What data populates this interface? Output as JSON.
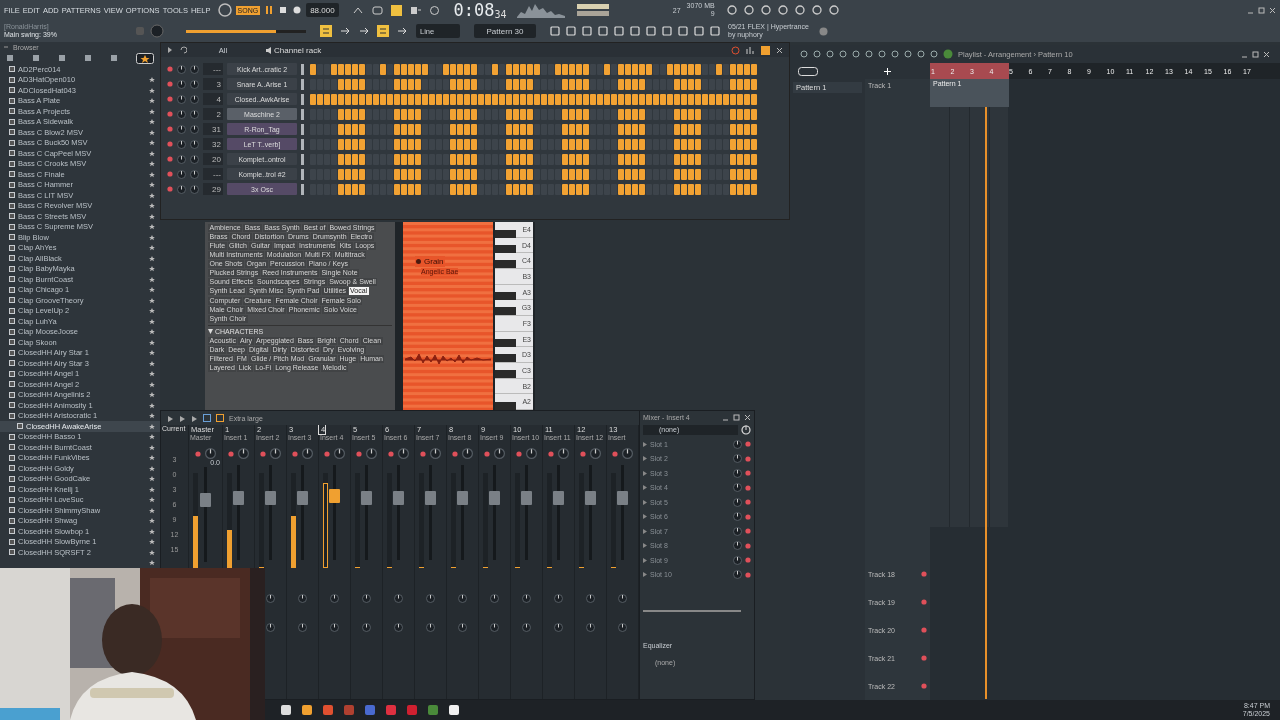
{
  "toolbar": {
    "menu": [
      "FILE",
      "EDIT",
      "ADD",
      "PATTERNS",
      "VIEW",
      "OPTIONS",
      "TOOLS",
      "HELP"
    ],
    "mode": "SONG",
    "tempo": "88.000",
    "time": "0:08",
    "time_small": "34",
    "cpu": "27",
    "memory": "3070 MB",
    "polyphony": "9",
    "hint_title": "[RonaldHarris]",
    "hint": "Main swing: 39%",
    "swing": {
      "level": 0.75
    },
    "snap": "Line",
    "pattern": "Pattern 30",
    "news": "05/21 FLEX | Hypertrance",
    "news_by": "by nuphory"
  },
  "browser": {
    "title": "Browser",
    "items": [
      {
        "label": "AD2Perc014",
        "selected": false
      },
      {
        "label": "AD3HatOpen010",
        "selected": false
      },
      {
        "label": "ADClosedHat043",
        "selected": false
      },
      {
        "label": "Bass A Plate",
        "selected": false
      },
      {
        "label": "Bass A Projects",
        "selected": false
      },
      {
        "label": "Bass A Sidewalk",
        "selected": false
      },
      {
        "label": "Bass C Blow2 MSV",
        "selected": false
      },
      {
        "label": "Bass C Buck50 MSV",
        "selected": false
      },
      {
        "label": "Bass C CapPeel MSV",
        "selected": false
      },
      {
        "label": "Bass C Crooks MSV",
        "selected": false
      },
      {
        "label": "Bass C Finale",
        "selected": false
      },
      {
        "label": "Bass C Hammer",
        "selected": false
      },
      {
        "label": "Bass C LIT MSV",
        "selected": false
      },
      {
        "label": "Bass C Revolver MSV",
        "selected": false
      },
      {
        "label": "Bass C Streets MSV",
        "selected": false
      },
      {
        "label": "Bass C Supreme MSV",
        "selected": false
      },
      {
        "label": "Blip Blow",
        "selected": false
      },
      {
        "label": "Clap AhYes",
        "selected": false
      },
      {
        "label": "Clap AllBlack",
        "selected": false
      },
      {
        "label": "Clap BabyMayka",
        "selected": false
      },
      {
        "label": "Clap BurntCoast",
        "selected": false
      },
      {
        "label": "Clap Chicago 1",
        "selected": false
      },
      {
        "label": "Clap GrooveTheory",
        "selected": false
      },
      {
        "label": "Clap LevelUp 2",
        "selected": false
      },
      {
        "label": "Clap LuhYa",
        "selected": false
      },
      {
        "label": "Clap MooseJoose",
        "selected": false
      },
      {
        "label": "Clap Skoon",
        "selected": false
      },
      {
        "label": "ClosedHH Airy Star 1",
        "selected": false
      },
      {
        "label": "ClosedHH Airy Star 3",
        "selected": false
      },
      {
        "label": "ClosedHH Angel 1",
        "selected": false
      },
      {
        "label": "ClosedHH Angel 2",
        "selected": false
      },
      {
        "label": "ClosedHH Angelinis 2",
        "selected": false
      },
      {
        "label": "ClosedHH Animosity 1",
        "selected": false
      },
      {
        "label": "ClosedHH Aristocratic 1",
        "selected": false
      },
      {
        "label": "ClosedHH AwakeArise",
        "selected": true
      },
      {
        "label": "ClosedHH Basso 1",
        "selected": false
      },
      {
        "label": "ClosedHH BurntCoast",
        "selected": false
      },
      {
        "label": "ClosedHH FunkVibes",
        "selected": false
      },
      {
        "label": "ClosedHH Goldy",
        "selected": false
      },
      {
        "label": "ClosedHH GoodCake",
        "selected": false
      },
      {
        "label": "ClosedHH Knellj 1",
        "selected": false
      },
      {
        "label": "ClosedHH LoveSuc",
        "selected": false
      },
      {
        "label": "ClosedHH ShimmyShaw",
        "selected": false
      },
      {
        "label": "ClosedHH Shwag",
        "selected": false
      },
      {
        "label": "ClosedHH Slowbop 1",
        "selected": false
      },
      {
        "label": "ClosedHH SlowByrne 1",
        "selected": false
      },
      {
        "label": "ClosedHH SQRSFT 2",
        "selected": false
      }
    ]
  },
  "channel_rack": {
    "filter": "All",
    "title": "Channel rack",
    "channels": [
      {
        "number": "---",
        "name": "Kick Art..cratic 2",
        "color": "#3b4148",
        "steps": [
          true,
          false,
          false,
          true,
          true,
          true,
          true,
          true,
          false,
          false,
          true,
          false,
          true,
          true,
          true,
          true,
          true,
          false,
          false,
          true,
          true,
          true,
          true,
          true,
          false,
          false,
          true,
          false,
          true,
          true,
          true,
          true,
          true,
          false,
          false,
          true,
          true,
          true,
          true,
          true,
          false,
          false,
          true,
          false,
          true,
          true,
          true,
          true,
          true,
          false,
          false,
          true,
          true,
          true,
          true,
          true,
          false,
          false,
          true,
          false,
          true,
          true,
          true,
          true
        ]
      },
      {
        "number": "3",
        "name": "Snare A..Arise 1",
        "color": "#3b4148",
        "steps": [
          false,
          false,
          false,
          false,
          true,
          true,
          true,
          true,
          false,
          false,
          false,
          false,
          true,
          true,
          true,
          true,
          false,
          false,
          false,
          false,
          true,
          true,
          true,
          true,
          false,
          false,
          false,
          false,
          true,
          true,
          true,
          true,
          false,
          false,
          false,
          false,
          true,
          true,
          true,
          true,
          false,
          false,
          false,
          false,
          true,
          true,
          true,
          true,
          false,
          false,
          false,
          false,
          true,
          true,
          true,
          true,
          false,
          false,
          false,
          false,
          true,
          true,
          true,
          true
        ]
      },
      {
        "number": "4",
        "name": "Closed..AwkArise",
        "color": "#3b4148",
        "steps": [
          true,
          true,
          true,
          true,
          true,
          true,
          true,
          true,
          true,
          true,
          true,
          true,
          true,
          true,
          true,
          true,
          true,
          true,
          true,
          true,
          true,
          true,
          true,
          true,
          true,
          true,
          true,
          true,
          true,
          true,
          true,
          true,
          true,
          true,
          true,
          true,
          true,
          true,
          true,
          true,
          true,
          true,
          true,
          true,
          true,
          true,
          true,
          true,
          true,
          true,
          true,
          true,
          true,
          true,
          true,
          true,
          true,
          true,
          true,
          true,
          true,
          true,
          true,
          true
        ]
      },
      {
        "number": "2",
        "name": "Maschine 2",
        "color": "#5a6068",
        "steps": [
          false,
          false,
          false,
          false,
          true,
          true,
          true,
          true,
          false,
          false,
          false,
          false,
          true,
          true,
          true,
          true,
          false,
          false,
          false,
          false,
          true,
          true,
          true,
          true,
          false,
          false,
          false,
          false,
          true,
          true,
          true,
          true,
          false,
          false,
          false,
          false,
          true,
          true,
          true,
          true,
          false,
          false,
          false,
          false,
          true,
          true,
          true,
          true,
          false,
          false,
          false,
          false,
          true,
          true,
          true,
          true,
          false,
          false,
          false,
          false,
          true,
          true,
          true,
          true
        ]
      },
      {
        "number": "31",
        "name": "R-Ron_Tag",
        "color": "#554a66",
        "steps": [
          false,
          false,
          false,
          false,
          true,
          true,
          true,
          true,
          false,
          false,
          false,
          false,
          true,
          true,
          true,
          true,
          false,
          false,
          false,
          false,
          true,
          true,
          true,
          true,
          false,
          false,
          false,
          false,
          true,
          true,
          true,
          true,
          false,
          false,
          false,
          false,
          true,
          true,
          true,
          true,
          false,
          false,
          false,
          false,
          true,
          true,
          true,
          true,
          false,
          false,
          false,
          false,
          true,
          true,
          true,
          true,
          false,
          false,
          false,
          false,
          true,
          true,
          true,
          true
        ]
      },
      {
        "number": "32",
        "name": "LeT T..verb]",
        "color": "#554a66",
        "steps": [
          false,
          false,
          false,
          false,
          true,
          true,
          true,
          true,
          false,
          false,
          false,
          false,
          true,
          true,
          true,
          true,
          false,
          false,
          false,
          false,
          true,
          true,
          true,
          true,
          false,
          false,
          false,
          false,
          true,
          true,
          true,
          true,
          false,
          false,
          false,
          false,
          true,
          true,
          true,
          true,
          false,
          false,
          false,
          false,
          true,
          true,
          true,
          true,
          false,
          false,
          false,
          false,
          true,
          true,
          true,
          true,
          false,
          false,
          false,
          false,
          true,
          true,
          true,
          true
        ]
      },
      {
        "number": "20",
        "name": "Komplet..ontrol",
        "color": "#3b4148",
        "steps": [
          false,
          false,
          false,
          false,
          true,
          true,
          true,
          true,
          false,
          false,
          false,
          false,
          true,
          true,
          true,
          true,
          false,
          false,
          false,
          false,
          true,
          true,
          true,
          true,
          false,
          false,
          false,
          false,
          true,
          true,
          true,
          true,
          false,
          false,
          false,
          false,
          true,
          true,
          true,
          true,
          false,
          false,
          false,
          false,
          true,
          true,
          true,
          true,
          false,
          false,
          false,
          false,
          true,
          true,
          true,
          true,
          false,
          false,
          false,
          false,
          true,
          true,
          true,
          true
        ]
      },
      {
        "number": "---",
        "name": "Komple..trol #2",
        "color": "#3b4148",
        "steps": [
          false,
          false,
          false,
          false,
          true,
          true,
          true,
          true,
          false,
          false,
          false,
          false,
          true,
          true,
          true,
          true,
          false,
          false,
          false,
          false,
          true,
          true,
          true,
          true,
          false,
          false,
          false,
          false,
          true,
          true,
          true,
          true,
          false,
          false,
          false,
          false,
          true,
          true,
          true,
          true,
          false,
          false,
          false,
          false,
          true,
          true,
          true,
          true,
          false,
          false,
          false,
          false,
          true,
          true,
          true,
          true,
          false,
          false,
          false,
          false,
          true,
          true,
          true,
          true
        ]
      },
      {
        "number": "29",
        "name": "3x Osc",
        "color": "#554a66",
        "steps": [
          false,
          false,
          false,
          false,
          true,
          true,
          true,
          true,
          false,
          false,
          false,
          false,
          true,
          true,
          true,
          true,
          false,
          false,
          false,
          false,
          true,
          true,
          true,
          true,
          false,
          false,
          false,
          false,
          true,
          true,
          true,
          true,
          false,
          false,
          false,
          false,
          true,
          true,
          true,
          true,
          false,
          false,
          false,
          false,
          true,
          true,
          true,
          true,
          false,
          false,
          false,
          false,
          true,
          true,
          true,
          true,
          false,
          false,
          false,
          false,
          true,
          true,
          true,
          true
        ]
      }
    ]
  },
  "tag_panel": {
    "types": [
      {
        "label": "Ambience",
        "selected": false
      },
      {
        "label": "Bass",
        "selected": false
      },
      {
        "label": "Bass Synth",
        "selected": false
      },
      {
        "label": "Best of",
        "selected": false
      },
      {
        "label": "Bowed Strings",
        "selected": false
      },
      {
        "label": "Brass",
        "selected": false
      },
      {
        "label": "Chord",
        "selected": false
      },
      {
        "label": "Distortion",
        "selected": false
      },
      {
        "label": "Drums",
        "selected": false
      },
      {
        "label": "Drumsynth",
        "selected": false
      },
      {
        "label": "Electro",
        "selected": false
      },
      {
        "label": "Flute",
        "selected": false
      },
      {
        "label": "Glitch",
        "selected": false
      },
      {
        "label": "Guitar",
        "selected": false
      },
      {
        "label": "Impact",
        "selected": false
      },
      {
        "label": "Instruments",
        "selected": false
      },
      {
        "label": "Kits",
        "selected": false
      },
      {
        "label": "Loops",
        "selected": false
      },
      {
        "label": "Multi Instruments",
        "selected": false
      },
      {
        "label": "Modulation",
        "selected": false
      },
      {
        "label": "Multi FX",
        "selected": false
      },
      {
        "label": "Multitrack",
        "selected": false
      },
      {
        "label": "One Shots",
        "selected": false
      },
      {
        "label": "Organ",
        "selected": false
      },
      {
        "label": "Percussion",
        "selected": false
      },
      {
        "label": "Piano / Keys",
        "selected": false
      },
      {
        "label": "Plucked Strings",
        "selected": false
      },
      {
        "label": "Reed Instruments",
        "selected": false
      },
      {
        "label": "Single Note",
        "selected": false
      },
      {
        "label": "Sound Effects",
        "selected": false
      },
      {
        "label": "Soundscapes",
        "selected": false
      },
      {
        "label": "Strings",
        "selected": false
      },
      {
        "label": "Swoop & Swell",
        "selected": false
      },
      {
        "label": "Synth Lead",
        "selected": false
      },
      {
        "label": "Synth Misc",
        "selected": false
      },
      {
        "label": "Synth Pad",
        "selected": false
      },
      {
        "label": "Utilities",
        "selected": false
      },
      {
        "label": "Vocal",
        "selected": true
      }
    ],
    "subtypes": [
      {
        "label": "Computer",
        "selected": false
      },
      {
        "label": "Creature",
        "selected": false
      },
      {
        "label": "Female Choir",
        "selected": false
      },
      {
        "label": "Female Solo",
        "selected": false
      },
      {
        "label": "Male Choir",
        "selected": false
      },
      {
        "label": "Mixed Choir",
        "selected": false
      },
      {
        "label": "Phonemic",
        "selected": false
      },
      {
        "label": "Solo Voice",
        "selected": false
      },
      {
        "label": "Synth Choir",
        "selected": false
      }
    ],
    "characters_title": "CHARACTERS",
    "characters": [
      {
        "label": "Acoustic",
        "selected": false
      },
      {
        "label": "Airy",
        "selected": false
      },
      {
        "label": "Arpeggiated",
        "selected": false
      },
      {
        "label": "Bass",
        "selected": false
      },
      {
        "label": "Bright",
        "selected": false
      },
      {
        "label": "Chord",
        "selected": false
      },
      {
        "label": "Clean",
        "selected": false
      },
      {
        "label": "Dark",
        "selected": false
      },
      {
        "label": "Deep",
        "selected": false
      },
      {
        "label": "Digital",
        "selected": false
      },
      {
        "label": "Dirty",
        "selected": false
      },
      {
        "label": "Distorted",
        "selected": false
      },
      {
        "label": "Dry",
        "selected": false
      },
      {
        "label": "Evolving",
        "selected": false
      },
      {
        "label": "Filtered",
        "selected": false
      },
      {
        "label": "FM",
        "selected": false
      },
      {
        "label": "Glide / Pitch Mod",
        "selected": false
      },
      {
        "label": "Granular",
        "selected": false
      },
      {
        "label": "Huge",
        "selected": false
      },
      {
        "label": "Human",
        "selected": false
      },
      {
        "label": "Layered",
        "selected": false
      },
      {
        "label": "Lick",
        "selected": false
      },
      {
        "label": "Lo-Fi",
        "selected": false
      },
      {
        "label": "Long Release",
        "selected": false
      },
      {
        "label": "Melodic",
        "selected": false
      }
    ],
    "preset": {
      "name": "Grain",
      "subtitle": "Angelic Bae"
    },
    "keys": [
      "E4",
      "D4",
      "C4",
      "B3",
      "A3",
      "G3",
      "F3",
      "E3",
      "D3",
      "C3",
      "B2",
      "A2"
    ]
  },
  "mixer": {
    "view": "Extra large",
    "current": "Current",
    "scale": [
      "3",
      "0",
      "3",
      "6",
      "9",
      "12",
      "15"
    ],
    "master": {
      "number": "Master",
      "name": "Master",
      "value": "0.0",
      "level": 0.55
    },
    "inserts": [
      {
        "number": "1",
        "name": "Insert 1",
        "level": 0.4,
        "selected": false
      },
      {
        "number": "2",
        "name": "Insert 2",
        "level": 0,
        "selected": false
      },
      {
        "number": "3",
        "name": "Insert 3",
        "level": 0.55,
        "selected": false
      },
      {
        "number": "4",
        "name": "Insert 4",
        "level": 0.9,
        "selected": true
      },
      {
        "number": "5",
        "name": "Insert 5",
        "level": 0,
        "selected": false
      },
      {
        "number": "6",
        "name": "Insert 6",
        "level": 0,
        "selected": false
      },
      {
        "number": "7",
        "name": "Insert 7",
        "level": 0,
        "selected": false
      },
      {
        "number": "8",
        "name": "Insert 8",
        "level": 0,
        "selected": false
      },
      {
        "number": "9",
        "name": "Insert 9",
        "level": 0,
        "selected": false
      },
      {
        "number": "10",
        "name": "Insert 10",
        "level": 0,
        "selected": false
      },
      {
        "number": "11",
        "name": "Insert 11",
        "level": 0,
        "selected": false
      },
      {
        "number": "12",
        "name": "Insert 12",
        "level": 0,
        "selected": false
      },
      {
        "number": "13",
        "name": "Insert",
        "level": 0,
        "selected": false
      }
    ],
    "panel": {
      "title": "Mixer - Insert 4",
      "input": "(none)",
      "slots": [
        "Slot 1",
        "Slot 2",
        "Slot 3",
        "Slot 4",
        "Slot 5",
        "Slot 6",
        "Slot 7",
        "Slot 8",
        "Slot 9",
        "Slot 10"
      ],
      "eq": "Equalizer",
      "output": "(none)"
    }
  },
  "playlist": {
    "title": "Playlist - Arrangement › Pattern 10",
    "patterns": [
      "Pattern 1"
    ],
    "bars": [
      "1",
      "2",
      "3",
      "4",
      "5",
      "6",
      "7",
      "8",
      "9",
      "10",
      "11",
      "12",
      "13",
      "14",
      "15",
      "16",
      "17"
    ],
    "clip": "Pattern 1",
    "top_tracks": [
      "Track 1"
    ],
    "bottom_tracks": [
      "Track 18",
      "Track 19",
      "Track 20",
      "Track 21",
      "Track 22"
    ]
  },
  "taskbar": {
    "time": "8:47 PM",
    "date": "7/5/2025"
  }
}
